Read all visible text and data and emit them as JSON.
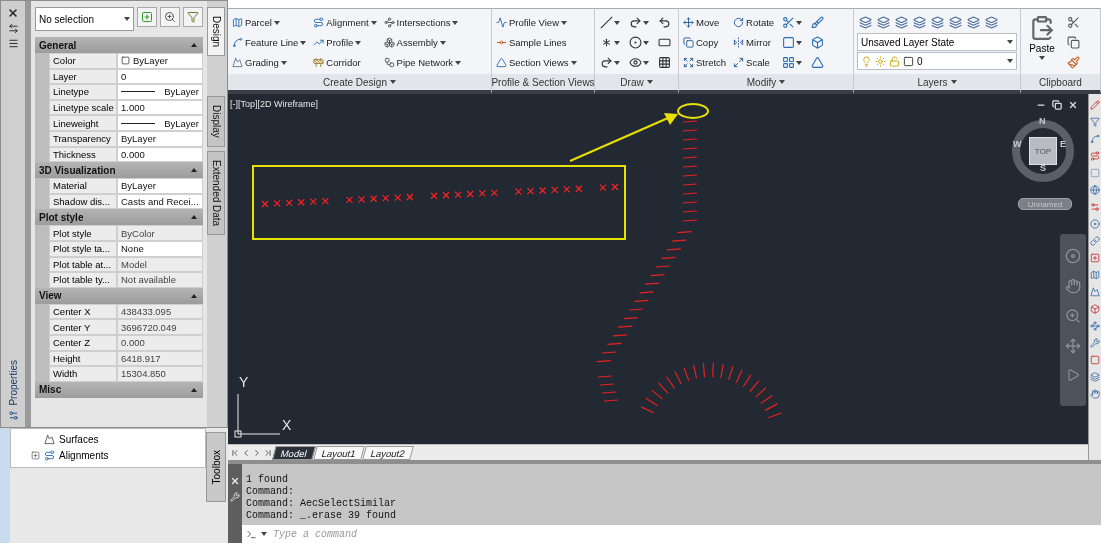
{
  "properties_palette": {
    "title": "Properties",
    "selection": "No selection",
    "sections": [
      {
        "title": "General",
        "expanded": true,
        "rows": [
          {
            "label": "Color",
            "value": "ByLayer",
            "kind": "color",
            "disabled": false
          },
          {
            "label": "Layer",
            "value": "0",
            "kind": "text",
            "disabled": false
          },
          {
            "label": "Linetype",
            "value": "ByLayer",
            "kind": "line",
            "disabled": false
          },
          {
            "label": "Linetype scale",
            "value": "1.000",
            "kind": "text",
            "disabled": false
          },
          {
            "label": "Lineweight",
            "value": "ByLayer",
            "kind": "line",
            "disabled": false
          },
          {
            "label": "Transparency",
            "value": "ByLayer",
            "kind": "text",
            "disabled": false
          },
          {
            "label": "Thickness",
            "value": "0.000",
            "kind": "text",
            "disabled": false
          }
        ]
      },
      {
        "title": "3D Visualization",
        "expanded": true,
        "rows": [
          {
            "label": "Material",
            "value": "ByLayer",
            "kind": "text",
            "disabled": false
          },
          {
            "label": "Shadow dis...",
            "value": "Casts and Recei...",
            "kind": "text",
            "disabled": false
          }
        ]
      },
      {
        "title": "Plot style",
        "expanded": true,
        "rows": [
          {
            "label": "Plot style",
            "value": "ByColor",
            "kind": "text",
            "disabled": true
          },
          {
            "label": "Plot style ta...",
            "value": "None",
            "kind": "text",
            "disabled": false
          },
          {
            "label": "Plot table at...",
            "value": "Model",
            "kind": "text",
            "disabled": true
          },
          {
            "label": "Plot table ty...",
            "value": "Not available",
            "kind": "text",
            "disabled": true
          }
        ]
      },
      {
        "title": "View",
        "expanded": true,
        "rows": [
          {
            "label": "Center X",
            "value": "438433.095",
            "kind": "text",
            "disabled": true
          },
          {
            "label": "Center Y",
            "value": "3696720.049",
            "kind": "text",
            "disabled": true
          },
          {
            "label": "Center Z",
            "value": "0.000",
            "kind": "text",
            "disabled": true
          },
          {
            "label": "Height",
            "value": "6418.917",
            "kind": "text",
            "disabled": true
          },
          {
            "label": "Width",
            "value": "15304.850",
            "kind": "text",
            "disabled": true
          }
        ]
      },
      {
        "title": "Misc",
        "expanded": true
      }
    ],
    "side_tabs": [
      {
        "label": "Design",
        "selected": true
      },
      {
        "label": "Display",
        "selected": false
      },
      {
        "label": "Extended Data",
        "selected": false
      }
    ]
  },
  "toolspace": {
    "items": [
      {
        "label": "Surfaces",
        "kind": "leaf"
      },
      {
        "label": "Alignments",
        "kind": "branch"
      }
    ],
    "toolbox_tab": "Toolbox"
  },
  "ribbon": {
    "panels": [
      {
        "title": "Create Design",
        "dropdown": true,
        "kind": "tools",
        "columns": [
          [
            {
              "label": "Parcel",
              "dropdown": true
            },
            {
              "label": "Feature Line",
              "dropdown": true
            },
            {
              "label": "Grading",
              "dropdown": true
            }
          ],
          [
            {
              "label": "Alignment",
              "dropdown": true
            },
            {
              "label": "Profile",
              "dropdown": true
            },
            {
              "label": "Corridor",
              "dropdown": false
            }
          ],
          [
            {
              "label": "Intersections",
              "dropdown": true
            },
            {
              "label": "Assembly",
              "dropdown": true
            },
            {
              "label": "Pipe Network",
              "dropdown": true
            }
          ]
        ]
      },
      {
        "title": "Profile & Section Views",
        "dropdown": false,
        "kind": "tools",
        "columns": [
          [
            {
              "label": "Profile View",
              "dropdown": true
            },
            {
              "label": "Sample Lines",
              "dropdown": false
            },
            {
              "label": "Section Views",
              "dropdown": true
            }
          ]
        ]
      },
      {
        "title": "Draw",
        "dropdown": true,
        "kind": "draw"
      },
      {
        "title": "Modify",
        "dropdown": true,
        "kind": "modify",
        "columns": [
          [
            {
              "label": "Move",
              "dropdown": false
            },
            {
              "label": "Copy",
              "dropdown": false
            },
            {
              "label": "Stretch",
              "dropdown": false
            }
          ],
          [
            {
              "label": "Rotate",
              "dropdown": false
            },
            {
              "label": "Mirror",
              "dropdown": false
            },
            {
              "label": "Scale",
              "dropdown": false
            }
          ]
        ]
      },
      {
        "title": "Layers",
        "dropdown": true,
        "kind": "layers",
        "layer_state": "Unsaved Layer State",
        "current_layer": "0"
      },
      {
        "title": "Clipboard",
        "dropdown": false,
        "kind": "clipboard",
        "paste_label": "Paste"
      }
    ]
  },
  "canvas": {
    "viewport_label": "[-][Top][2D Wireframe]",
    "viewcube": {
      "face": "TOP",
      "north": "N",
      "east": "E",
      "south": "S",
      "west": "W",
      "view_name": "Unnamed"
    },
    "ucs": {
      "x": "X",
      "y": "Y"
    },
    "layout_tabs": [
      {
        "label": "Model",
        "selected": true
      },
      {
        "label": "Layout1",
        "selected": false
      },
      {
        "label": "Layout2",
        "selected": false
      }
    ]
  },
  "command_line": {
    "history": [
      "1 found",
      "Command:",
      "Command: AecSelectSimilar",
      "Command: _.erase 39 found"
    ],
    "placeholder": "Type a command"
  }
}
